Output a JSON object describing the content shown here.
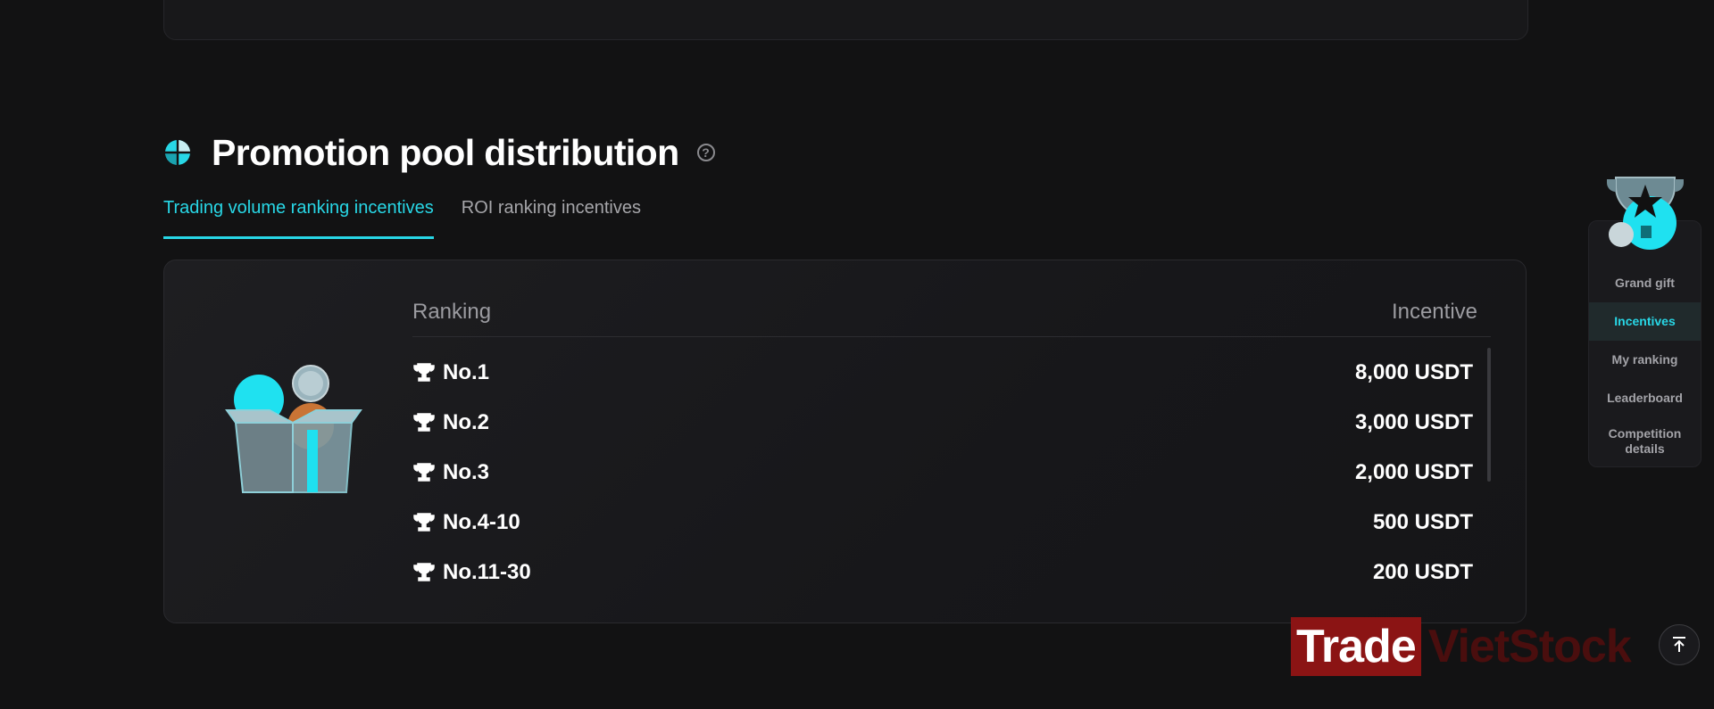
{
  "section": {
    "title": "Promotion pool distribution",
    "help": "?"
  },
  "tabs": [
    {
      "label": "Trading volume ranking incentives",
      "active": true
    },
    {
      "label": "ROI ranking incentives",
      "active": false
    }
  ],
  "table": {
    "headers": {
      "ranking": "Ranking",
      "incentive": "Incentive"
    },
    "rows": [
      {
        "rank": "No.1",
        "incentive": "8,000 USDT"
      },
      {
        "rank": "No.2",
        "incentive": "3,000 USDT"
      },
      {
        "rank": "No.3",
        "incentive": "2,000 USDT"
      },
      {
        "rank": "No.4-10",
        "incentive": "500 USDT"
      },
      {
        "rank": "No.11-30",
        "incentive": "200 USDT"
      }
    ]
  },
  "side_nav": {
    "items": [
      {
        "label": "Grand gift",
        "active": false
      },
      {
        "label": "Incentives",
        "active": true
      },
      {
        "label": "My ranking",
        "active": false
      },
      {
        "label": "Leaderboard",
        "active": false
      },
      {
        "label": "Competition details",
        "active": false
      }
    ]
  },
  "watermark": {
    "part1": "Trade",
    "part2": "VietStock"
  },
  "colors": {
    "accent": "#28d7e6",
    "background": "#121213"
  },
  "icons": {
    "section": "pie-chart-icon",
    "help": "help-circle-icon",
    "rank": "trophy-icon",
    "scroll": "scroll-to-top-icon"
  }
}
